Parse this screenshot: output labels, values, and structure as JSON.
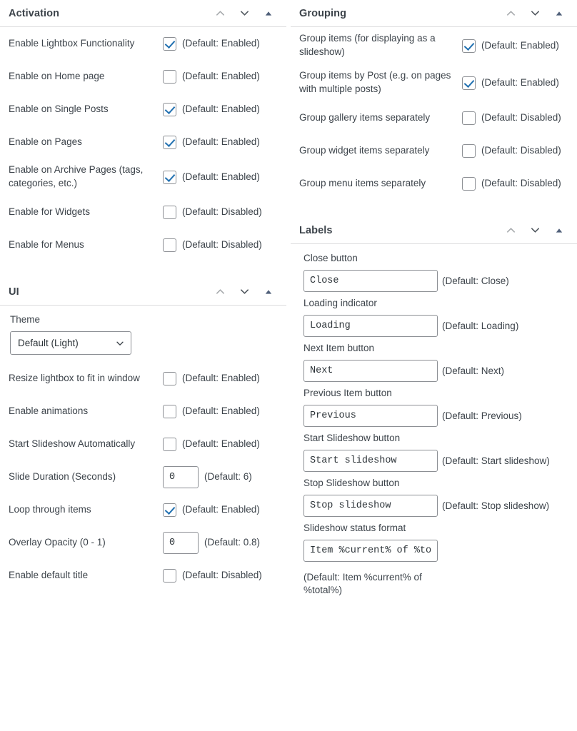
{
  "icons": {
    "chevron_up": "chevron-up-icon",
    "chevron_down": "chevron-down-icon",
    "collapse_triangle": "collapse-triangle-icon",
    "select_chevron": "chevron-down-icon"
  },
  "colors": {
    "checkmark": "#2271b1",
    "header_text": "#3c434a",
    "body_text": "#3c434a",
    "border": "#8c8f94",
    "divider": "#dcdcde"
  },
  "left_column": {
    "sections": [
      {
        "title": "Activation",
        "rows": [
          {
            "label": "Enable Lightbox Functionality",
            "checked": true,
            "default": "(Default: Enabled)"
          },
          {
            "label": "Enable on Home page",
            "checked": false,
            "default": "(Default: Enabled)"
          },
          {
            "label": "Enable on Single Posts",
            "checked": true,
            "default": "(Default: Enabled)"
          },
          {
            "label": "Enable on Pages",
            "checked": true,
            "default": "(Default: Enabled)"
          },
          {
            "label": "Enable on Archive Pages (tags, categories, etc.)",
            "checked": true,
            "default": "(Default: Enabled)"
          },
          {
            "label": "Enable for Widgets",
            "checked": false,
            "default": "(Default: Disabled)"
          },
          {
            "label": "Enable for Menus",
            "checked": false,
            "default": "(Default: Disabled)"
          }
        ]
      },
      {
        "title": "UI",
        "theme": {
          "label": "Theme",
          "value": "Default (Light)",
          "options": [
            "Default (Light)"
          ]
        },
        "rows": [
          {
            "label": "Resize lightbox to fit in window",
            "checked": false,
            "default": "(Default: Enabled)"
          },
          {
            "label": "Enable animations",
            "checked": false,
            "default": "(Default: Enabled)"
          },
          {
            "label": "Start Slideshow Automatically",
            "checked": false,
            "default": "(Default: Enabled)"
          }
        ],
        "number_rows": [
          {
            "label": "Slide Duration (Seconds)",
            "value": "0",
            "default": "(Default: 6)"
          }
        ],
        "rows_after": [
          {
            "label": "Loop through items",
            "checked": true,
            "default": "(Default: Enabled)"
          }
        ],
        "number_rows_after": [
          {
            "label": "Overlay Opacity (0 - 1)",
            "value": "0",
            "default": "(Default: 0.8)"
          }
        ],
        "rows_last": [
          {
            "label": "Enable default title",
            "checked": false,
            "default": "(Default: Disabled)"
          }
        ]
      }
    ]
  },
  "right_column": {
    "sections": [
      {
        "title": "Grouping",
        "rows": [
          {
            "label": "Group items (for displaying as a slideshow)",
            "checked": true,
            "default": "(Default: Enabled)"
          },
          {
            "label": "Group items by Post (e.g. on pages with multiple posts)",
            "checked": true,
            "default": "(Default: Enabled)"
          },
          {
            "label": "Group gallery items separately",
            "checked": false,
            "default": "(Default: Disabled)"
          },
          {
            "label": "Group widget items separately",
            "checked": false,
            "default": "(Default: Disabled)"
          },
          {
            "label": "Group menu items separately",
            "checked": false,
            "default": "(Default: Disabled)"
          }
        ]
      },
      {
        "title": "Labels",
        "fields": [
          {
            "label": "Close button",
            "value": "Close",
            "default": "(Default: Close)"
          },
          {
            "label": "Loading indicator",
            "value": "Loading",
            "default": "(Default: Loading)"
          },
          {
            "label": "Next Item button",
            "value": "Next",
            "default": "(Default: Next)"
          },
          {
            "label": "Previous Item button",
            "value": "Previous",
            "default": "(Default: Previous)"
          },
          {
            "label": "Start Slideshow button",
            "value": "Start slideshow",
            "default": "(Default: Start slideshow)"
          },
          {
            "label": "Stop Slideshow button",
            "value": "Stop slideshow",
            "default": "(Default: Stop slideshow)"
          },
          {
            "label": "Slideshow status format",
            "value": "Item %current% of %total%",
            "default": "(Default: Item %current% of %total%)"
          }
        ]
      }
    ]
  }
}
